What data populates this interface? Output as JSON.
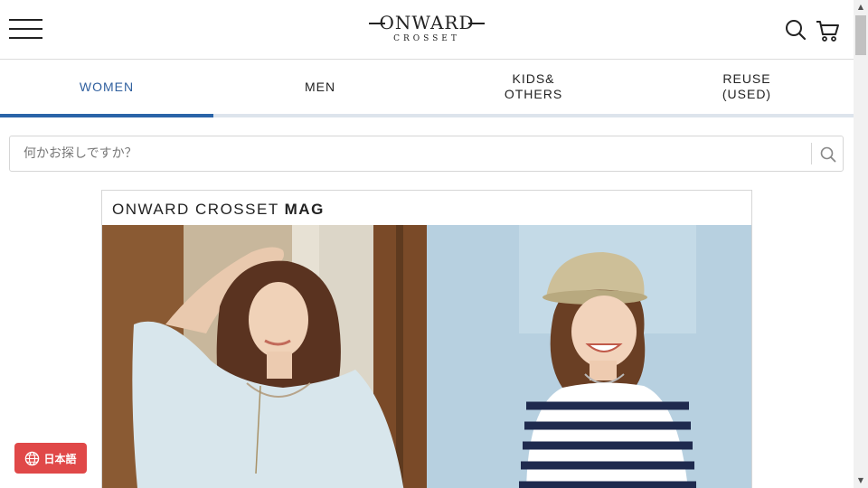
{
  "header": {
    "logo_main": "ONWARD",
    "logo_sub": "CROSSET"
  },
  "tabs": [
    {
      "label": "WOMEN",
      "active": true
    },
    {
      "label": "MEN",
      "active": false
    },
    {
      "label": "KIDS&\nOTHERS",
      "active": false
    },
    {
      "label": "REUSE\n(USED)",
      "active": false
    }
  ],
  "search": {
    "placeholder": "何かお探しですか？"
  },
  "magazine": {
    "title_regular": "ONWARD CROSSET ",
    "title_bold": "MAG"
  },
  "language": {
    "label": "日本語"
  },
  "colors": {
    "accent": "#2a64a8",
    "tab_inactive_line": "#dde4ec",
    "language_button": "#e04848"
  },
  "icons": {
    "menu": "hamburger-icon",
    "search": "search-icon",
    "cart": "cart-icon",
    "language": "globe-icon"
  }
}
